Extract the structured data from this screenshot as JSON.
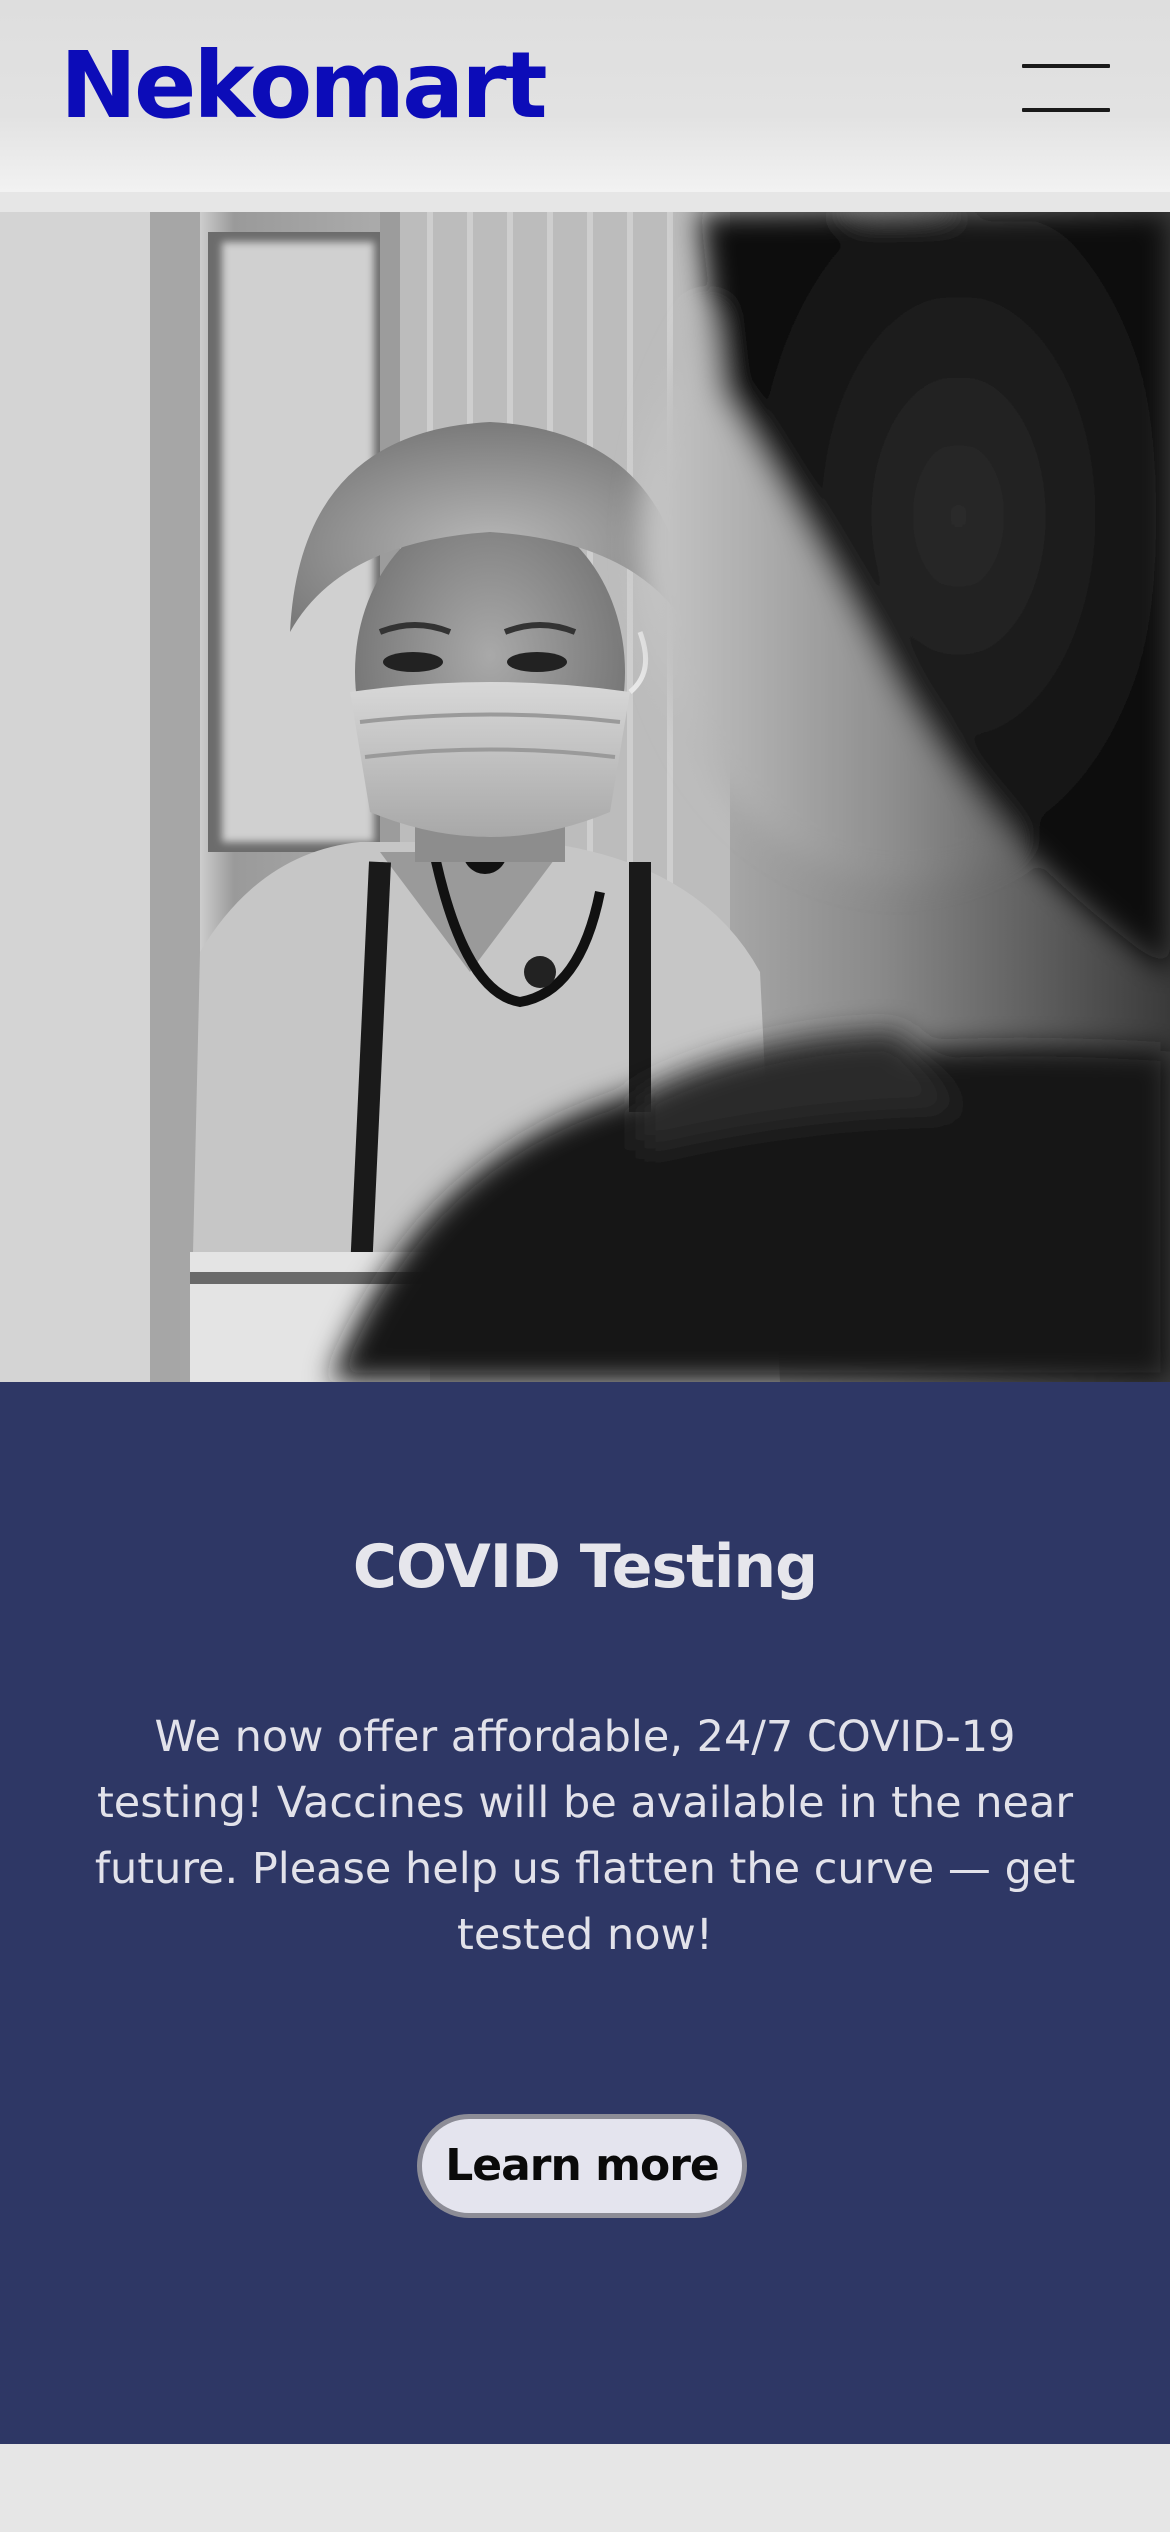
{
  "header": {
    "logo_text": "Nekomart",
    "menu_icon": "hamburger-menu-icon"
  },
  "hero": {
    "image_subject": "healthcare worker in mask with stethoscope"
  },
  "promo": {
    "title": "COVID Testing",
    "body": "We now offer affordable, 24/7 COVID-19 testing! Vaccines will be available in the near future. Please help us flatten the curve — get tested now!",
    "button_label": "Learn more"
  },
  "colors": {
    "brand": "#0c0cb8",
    "promo_background": "#2e3765",
    "button_background": "#e4e4ee",
    "page_background": "#e6e6e6"
  }
}
